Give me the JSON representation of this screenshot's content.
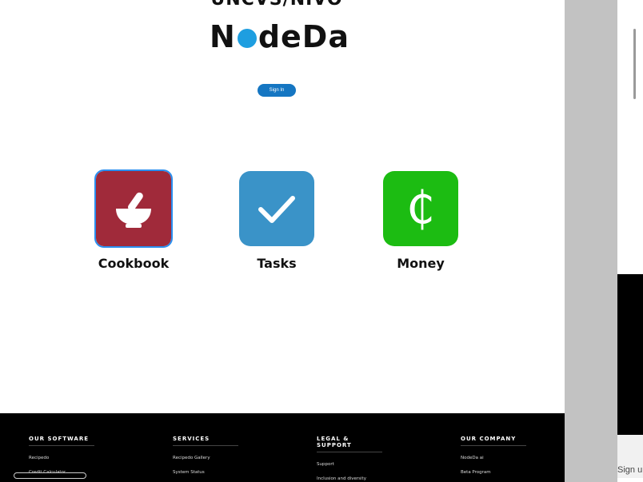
{
  "header": {
    "cut_title": "UNCVS/NIVO",
    "logo_left": "N",
    "logo_right": "deDa",
    "signin_label": "Sign In"
  },
  "apps": [
    {
      "label": "Cookbook",
      "color": "#a02a3a",
      "icon": "mortar-pestle-icon"
    },
    {
      "label": "Tasks",
      "color": "#3a93c8",
      "icon": "checkmark-icon"
    },
    {
      "label": "Money",
      "color": "#1cbc12",
      "icon": "cedi-sign-icon",
      "glyph": "₵"
    }
  ],
  "footer": {
    "columns": [
      {
        "heading": "OUR SOFTWARE",
        "links": [
          "Recipedo",
          "Credit Calculator"
        ]
      },
      {
        "heading": "SERVICES",
        "links": [
          "Recipedo Gallery",
          "System Status"
        ]
      },
      {
        "heading": "LEGAL & SUPPORT",
        "links": [
          "Support",
          "Inclusion and diversity"
        ]
      },
      {
        "heading": "OUR COMPANY",
        "links": [
          "NodeDa ai",
          "Beta Program"
        ]
      }
    ]
  },
  "side_panel": {
    "signup_text": "Sign up"
  }
}
